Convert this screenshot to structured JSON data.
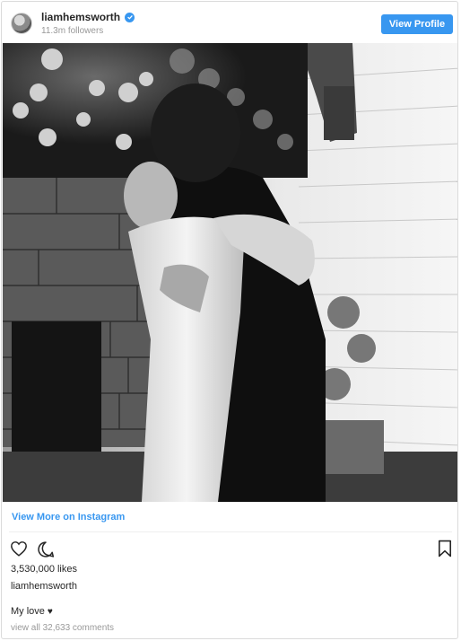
{
  "header": {
    "username": "liamhemsworth",
    "followers": "11.3m followers",
    "view_profile_label": "View Profile",
    "verified_icon": "verified-badge-icon"
  },
  "post": {
    "image_alt": "Black and white wedding photo of a couple embracing",
    "view_more_label": "View More on Instagram",
    "likes": "3,530,000 likes",
    "caption_username": "liamhemsworth",
    "caption_text": "My love",
    "caption_emoji": "♥",
    "view_comments": "view all 32,633 comments"
  },
  "actions": {
    "like_icon": "heart-icon",
    "comment_icon": "comment-icon",
    "save_icon": "bookmark-icon"
  },
  "colors": {
    "accent": "#3897f0",
    "text": "#262626",
    "muted": "#999999",
    "border": "#dbdbdb"
  }
}
